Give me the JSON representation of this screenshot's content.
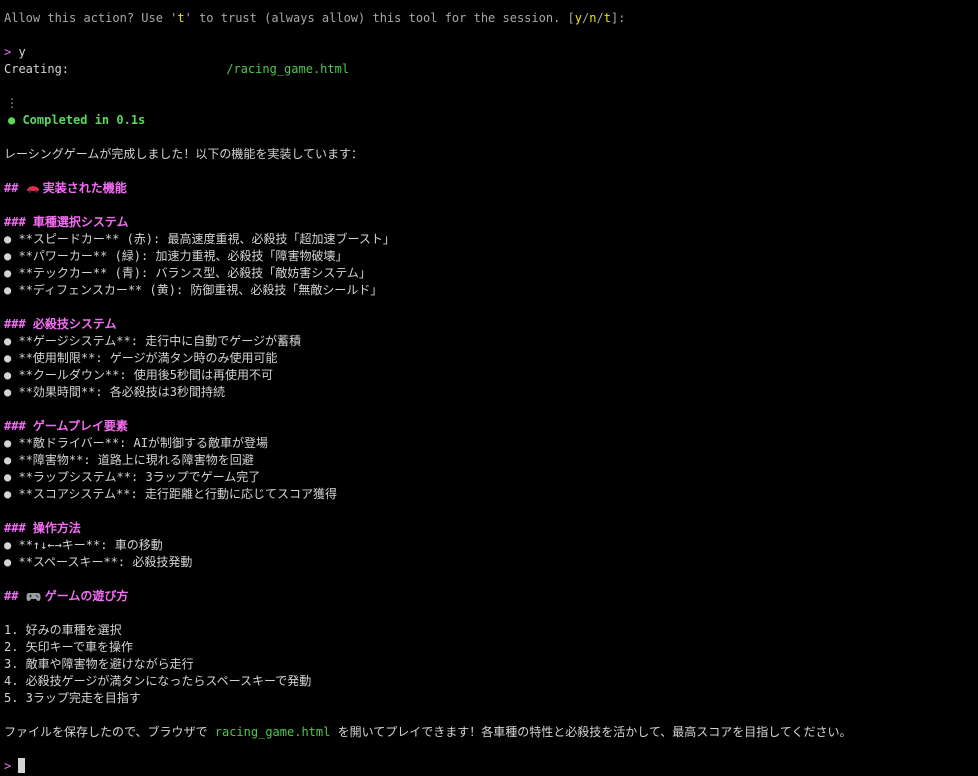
{
  "permission": {
    "prefix": "Allow this action? Use '",
    "key": "t",
    "suffix": "' to trust (always allow) this tool for the session. [",
    "opt_y": "y",
    "sep1": "/",
    "opt_n": "n",
    "sep2": "/",
    "opt_t": "t",
    "end": "]:"
  },
  "input": {
    "prompt": ">",
    "answer": "y"
  },
  "creating": {
    "label": "Creating: ",
    "path": "/racing_game.html"
  },
  "status": {
    "ellipsis": "⋮",
    "completed": "● Completed in 0.1s"
  },
  "intro": "レーシングゲームが完成しました！以下の機能を実装しています：",
  "h_features": {
    "hash": "## ",
    "icon": "race-car-icon",
    "text": "実装された機能"
  },
  "sections": [
    {
      "heading": "### 車種選択システム",
      "items": [
        "● **スピードカー** (赤): 最高速度重視、必殺技「超加速ブースト」",
        "● **パワーカー** (緑): 加速力重視、必殺技「障害物破壊」",
        "● **テックカー** (青): バランス型、必殺技「敵妨害システム」",
        "● **ディフェンスカー** (黄): 防御重視、必殺技「無敵シールド」"
      ]
    },
    {
      "heading": "### 必殺技システム",
      "items": [
        "● **ゲージシステム**: 走行中に自動でゲージが蓄積",
        "● **使用制限**: ゲージが満タン時のみ使用可能",
        "● **クールダウン**: 使用後5秒間は再使用不可",
        "● **効果時間**: 各必殺技は3秒間持続"
      ]
    },
    {
      "heading": "### ゲームプレイ要素",
      "items": [
        "● **敵ドライバー**: AIが制御する敵車が登場",
        "● **障害物**: 道路上に現れる障害物を回避",
        "● **ラップシステム**: 3ラップでゲーム完了",
        "● **スコアシステム**: 走行距離と行動に応じてスコア獲得"
      ]
    },
    {
      "heading": "### 操作方法",
      "items": [
        "● **↑↓←→キー**: 車の移動",
        "● **スペースキー**: 必殺技発動"
      ]
    }
  ],
  "h_howto": {
    "hash": "## ",
    "icon": "gamepad-icon",
    "text": "ゲームの遊び方"
  },
  "steps": [
    "1. 好みの車種を選択",
    "2. 矢印キーで車を操作",
    "3. 敵車や障害物を避けながら走行",
    "4. 必殺技ゲージが満タンになったらスペースキーで発動",
    "5. 3ラップ完走を目指す"
  ],
  "outro": {
    "before": "ファイルを保存したので、ブラウザで ",
    "file": "racing_game.html",
    "after": " を開いてプレイできます！各車種の特性と必殺技を活かして、最高スコアを目指してください。"
  },
  "final_prompt": ">",
  "colors": {
    "background": "#000000",
    "text": "#d4d4d4",
    "heading": "#f36df3",
    "success": "#58d858",
    "option": "#e5e510"
  }
}
